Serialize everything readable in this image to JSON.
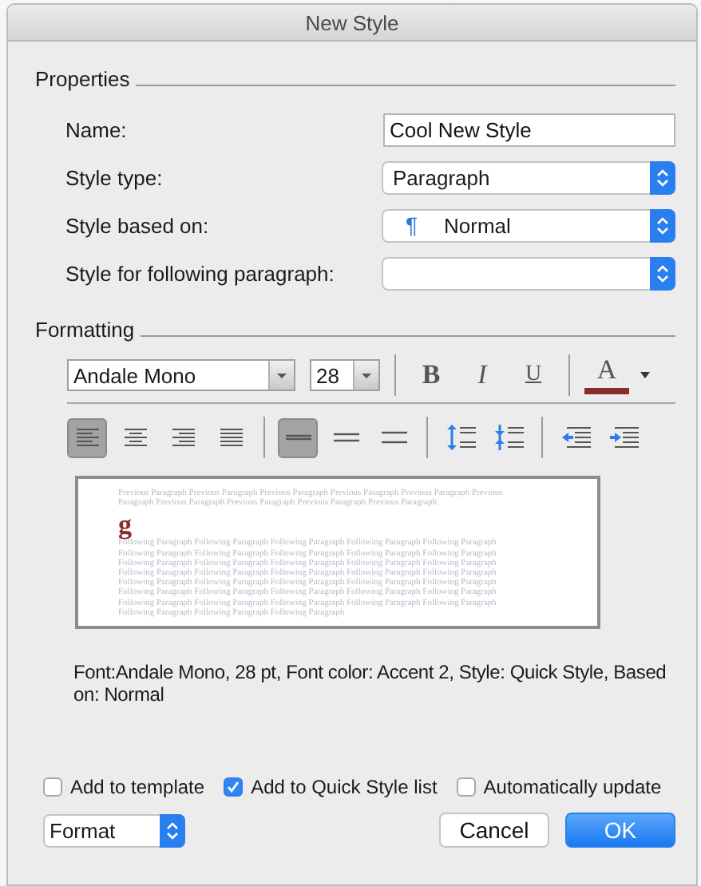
{
  "window": {
    "title": "New Style"
  },
  "properties": {
    "heading": "Properties",
    "fields": [
      {
        "kind": "text",
        "label": "Name:",
        "value": "Cool New Style"
      },
      {
        "kind": "select",
        "label": "Style type:",
        "value": "Paragraph"
      },
      {
        "kind": "select",
        "label": "Style based on:",
        "value": "Normal",
        "marker": "¶"
      },
      {
        "kind": "select",
        "label": "Style for following paragraph:"
      }
    ]
  },
  "formatting": {
    "heading": "Formatting",
    "font": "Andale Mono",
    "size": "28",
    "styles": [
      {
        "kind": "bold",
        "label": "B"
      },
      {
        "kind": "italic",
        "label": "I"
      },
      {
        "kind": "underline",
        "label": "U"
      }
    ],
    "font_color": {
      "label": "A",
      "color": "#8b2a2a"
    },
    "alignment": [
      {
        "kind": "left",
        "selected": true
      },
      {
        "kind": "center",
        "selected": false
      },
      {
        "kind": "right",
        "selected": false
      },
      {
        "kind": "justify",
        "selected": false
      }
    ],
    "line_spacing": [
      {
        "kind": "single",
        "selected": true
      },
      {
        "kind": "onehalf",
        "selected": false
      },
      {
        "kind": "double",
        "selected": false
      }
    ],
    "paragraph_spacing": [
      {
        "kind": "increase"
      },
      {
        "kind": "decrease"
      }
    ],
    "indent": [
      {
        "kind": "decrease"
      },
      {
        "kind": "increase"
      }
    ]
  },
  "preview": {
    "previous": "Previous Paragraph Previous Paragraph Previous Paragraph Previous Paragraph Previous Paragraph Previous Paragraph Previous Paragraph Previous Paragraph Previous Paragraph Previous Paragraph",
    "sample": "g",
    "following": "Following Paragraph Following Paragraph Following Paragraph Following Paragraph Following Paragraph Following Paragraph Following Paragraph Following Paragraph Following Paragraph Following Paragraph Following Paragraph Following Paragraph Following Paragraph Following Paragraph Following Paragraph Following Paragraph Following Paragraph Following Paragraph Following Paragraph Following Paragraph Following Paragraph Following Paragraph Following Paragraph Following Paragraph Following Paragraph Following Paragraph Following Paragraph Following Paragraph Following Paragraph Following Paragraph Following Paragraph Following Paragraph Following Paragraph Following Paragraph Following Paragraph Following Paragraph Following Paragraph Following Paragraph"
  },
  "description": "Font:Andale Mono, 28 pt, Font color: Accent 2, Style: Quick Style, Based on: Normal",
  "options": [
    {
      "label": "Add to template",
      "checked": false
    },
    {
      "label": "Add to Quick Style list",
      "checked": true
    },
    {
      "label": "Automatically update",
      "checked": false
    }
  ],
  "format_menu": "Format",
  "buttons": [
    {
      "label": "Cancel",
      "kind": "normal"
    },
    {
      "label": "OK",
      "kind": "default"
    }
  ]
}
